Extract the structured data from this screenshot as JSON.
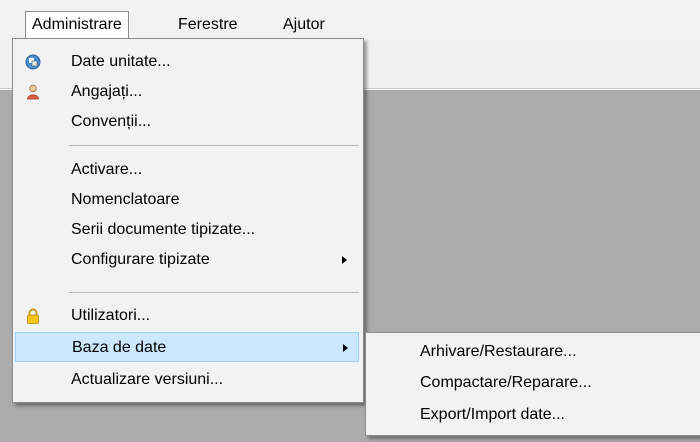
{
  "menubar": {
    "items": [
      "Administrare",
      "Ferestre",
      "Ajutor"
    ]
  },
  "dropdown": {
    "items": [
      {
        "label": "Date unitate...",
        "icon": "database-icon"
      },
      {
        "label": "Angajați...",
        "icon": "user-icon"
      },
      {
        "label": "Convenții..."
      },
      {
        "label": "Activare..."
      },
      {
        "label": "Nomenclatoare"
      },
      {
        "label": "Serii documente tipizate..."
      },
      {
        "label": "Configurare tipizate",
        "has_submenu": true
      },
      {
        "label": "Utilizatori...",
        "icon": "lock-icon"
      },
      {
        "label": "Baza de date",
        "has_submenu": true,
        "highlighted": true
      },
      {
        "label": "Actualizare versiuni..."
      }
    ]
  },
  "submenu": {
    "items": [
      {
        "label": "Arhivare/Restaurare..."
      },
      {
        "label": "Compactare/Reparare..."
      },
      {
        "label": "Export/Import date..."
      }
    ]
  },
  "colors": {
    "highlight_bg": "#cce8ff",
    "highlight_border": "#99d1ff",
    "workspace": "#ababab"
  }
}
